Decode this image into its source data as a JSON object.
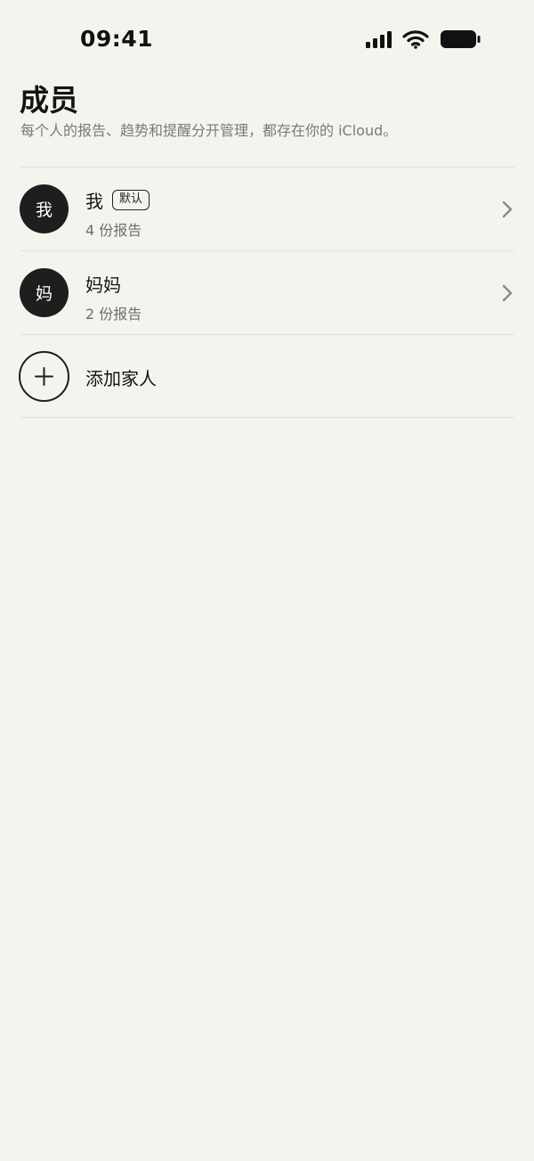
{
  "status_bar": {
    "time": "09:41"
  },
  "header": {
    "title": "成员",
    "subtitle": "每个人的报告、趋势和提醒分开管理，都存在你的 iCloud。"
  },
  "members": [
    {
      "initial": "我",
      "name": "我",
      "badge": "默认",
      "reports": "4 份报告"
    },
    {
      "initial": "妈",
      "name": "妈妈",
      "reports": "2 份报告"
    }
  ],
  "add_member": {
    "label": "添加家人"
  },
  "icons": {
    "signal": "cellular-signal-icon",
    "wifi": "wifi-icon",
    "battery": "battery-icon",
    "chevron": "chevron-right-icon",
    "plus": "plus-icon"
  },
  "colors": {
    "background": "#F4F3EE",
    "avatar": "#1E1E1E",
    "muted_text": "#7A7A76"
  }
}
